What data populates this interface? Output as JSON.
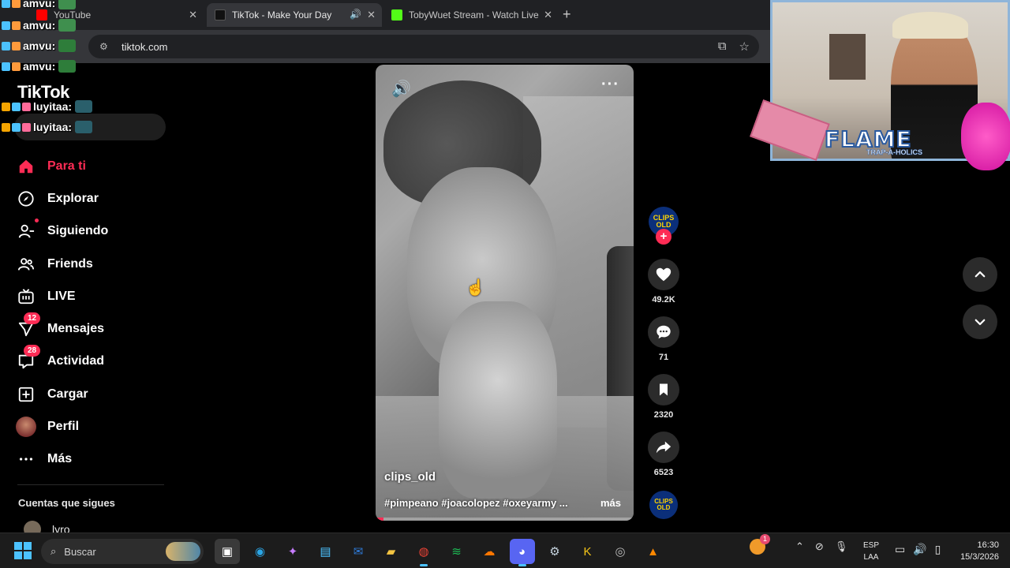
{
  "browser": {
    "tabs": [
      {
        "title": "YouTube",
        "close": "✕"
      },
      {
        "title": "TikTok - Make Your Day",
        "close": "✕",
        "speaker": "🔊"
      },
      {
        "title": "TobyWuet Stream - Watch Live",
        "close": "✕"
      }
    ],
    "new_tab": "+",
    "address": "tiktok.com"
  },
  "chat": [
    {
      "user": "amvu:",
      "color": "#ffffff"
    },
    {
      "user": "amvu:",
      "color": "#ffffff"
    },
    {
      "user": "amvu:",
      "color": "#ffffff"
    },
    {
      "user": "amvu:",
      "color": "#ffffff"
    },
    {
      "user": "luyitaa:",
      "color": "#ffffff"
    },
    {
      "user": "luyitaa:",
      "color": "#ffffff"
    }
  ],
  "tiktok": {
    "logo": "TikTok",
    "accent": "#fe2c55",
    "nav": [
      {
        "label": "Para ti",
        "icon": "home-icon"
      },
      {
        "label": "Explorar",
        "icon": "compass-icon"
      },
      {
        "label": "Siguiendo",
        "icon": "following-icon"
      },
      {
        "label": "Friends",
        "icon": "friends-icon"
      },
      {
        "label": "LIVE",
        "icon": "live-icon"
      },
      {
        "label": "Mensajes",
        "icon": "messages-icon",
        "badge": "12"
      },
      {
        "label": "Actividad",
        "icon": "activity-icon",
        "badge": "28"
      },
      {
        "label": "Cargar",
        "icon": "upload-icon"
      },
      {
        "label": "Perfil",
        "icon": "profile-icon"
      },
      {
        "label": "Más",
        "icon": "more-icon"
      }
    ],
    "following_title": "Cuentas que sigues",
    "following_first": "lyro"
  },
  "video": {
    "author": "clips_old",
    "caption": "#pimpeano #joacolopez #oxeyarmy ...",
    "more_label": "más",
    "progress_fraction": 0.03,
    "account_badge": "CLIPS OLD",
    "likes": "49.2K",
    "comments": "71",
    "saves": "2320",
    "shares": "6523"
  },
  "overlay": {
    "brand": "FLAME",
    "brand_sub": "TRAP-A-HOLICS"
  },
  "taskbar": {
    "search_placeholder": "Buscar",
    "lang_top": "ESP",
    "lang_bottom": "LAA",
    "time": "16:30",
    "date": "15/3/2026",
    "notification_count": "1"
  }
}
